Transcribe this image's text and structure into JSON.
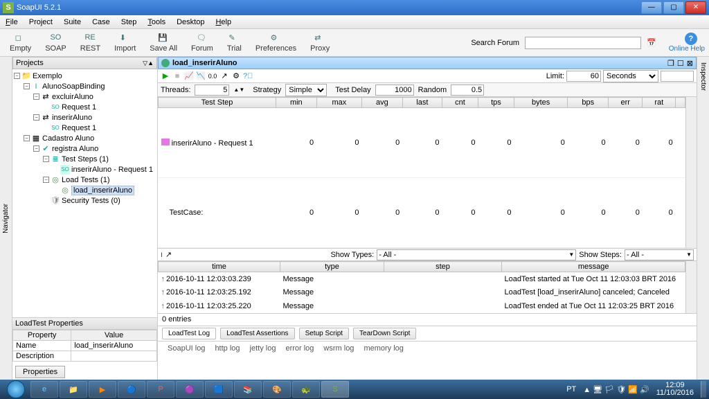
{
  "titlebar": {
    "title": "SoapUI 5.2.1"
  },
  "menu": [
    "File",
    "Project",
    "Suite",
    "Case",
    "Step",
    "Tools",
    "Desktop",
    "Help"
  ],
  "toolbar": {
    "items": [
      "Empty",
      "SOAP",
      "REST",
      "Import",
      "Save All",
      "Forum",
      "Trial",
      "Preferences",
      "Proxy"
    ],
    "search_label": "Search Forum",
    "help": "Online Help"
  },
  "nav": {
    "title": "Projects",
    "tree": {
      "root": "Exemplo",
      "binding": "AlunoSoapBinding",
      "excluir": "excluirAluno",
      "excluir_req": "Request 1",
      "inserir": "inserirAluno",
      "inserir_req": "Request 1",
      "cadastro": "Cadastro Aluno",
      "registra": "registra Aluno",
      "steps": "Test Steps (1)",
      "step1": "inserirAluno - Request 1",
      "loadtests": "Load Tests (1)",
      "lt1": "load_inserirAluno",
      "sectests": "Security Tests (0)"
    },
    "props_title": "LoadTest Properties",
    "prop_h1": "Property",
    "prop_h2": "Value",
    "prop_name": "Name",
    "prop_name_v": "load_inserirAluno",
    "prop_desc": "Description",
    "props_btn": "Properties",
    "navigator": "Navigator"
  },
  "doc": {
    "title": "load_inserirAluno",
    "limit_label": "Limit:",
    "limit_val": "60",
    "limit_unit": "Seconds",
    "threads_label": "Threads:",
    "threads_val": "5",
    "strategy_label": "Strategy",
    "strategy_val": "Simple",
    "delay_label": "Test Delay",
    "delay_val": "1000",
    "random_label": "Random",
    "random_val": "0.5"
  },
  "grid": {
    "headers": [
      "Test Step",
      "min",
      "max",
      "avg",
      "last",
      "cnt",
      "tps",
      "bytes",
      "bps",
      "err",
      "rat"
    ],
    "rows": [
      {
        "name": "inserirAluno - Request 1",
        "min": "0",
        "max": "0",
        "avg": "0",
        "last": "0",
        "cnt": "0",
        "tps": "0",
        "bytes": "0",
        "bps": "0",
        "err": "0",
        "rat": "0"
      },
      {
        "name": "TestCase:",
        "min": "0",
        "max": "0",
        "avg": "0",
        "last": "0",
        "cnt": "0",
        "tps": "0",
        "bytes": "0",
        "bps": "0",
        "err": "0",
        "rat": "0"
      }
    ]
  },
  "log": {
    "show_types": "Show Types:",
    "all": "- All -",
    "show_steps": "Show Steps:",
    "headers": [
      "time",
      "type",
      "step",
      "message"
    ],
    "rows": [
      {
        "time": "2016-10-11 12:03:03.239",
        "type": "Message",
        "step": "",
        "msg": "LoadTest started at Tue Oct 11 12:03:03 BRT 2016"
      },
      {
        "time": "2016-10-11 12:03:25.192",
        "type": "Message",
        "step": "",
        "msg": "LoadTest [load_inserirAluno] canceled; Canceled"
      },
      {
        "time": "2016-10-11 12:03:25.220",
        "type": "Message",
        "step": "",
        "msg": "LoadTest ended at Tue Oct 11 12:03:25 BRT 2016"
      }
    ],
    "entries": "0 entries",
    "tabs": [
      "LoadTest Log",
      "LoadTest Assertions",
      "Setup Script",
      "TearDown Script"
    ],
    "btabs": [
      "SoapUI log",
      "http log",
      "jetty log",
      "error log",
      "wsrm log",
      "memory log"
    ]
  },
  "inspector": "Inspector",
  "task": {
    "lang": "PT",
    "time": "12:09",
    "date": "11/10/2016"
  }
}
